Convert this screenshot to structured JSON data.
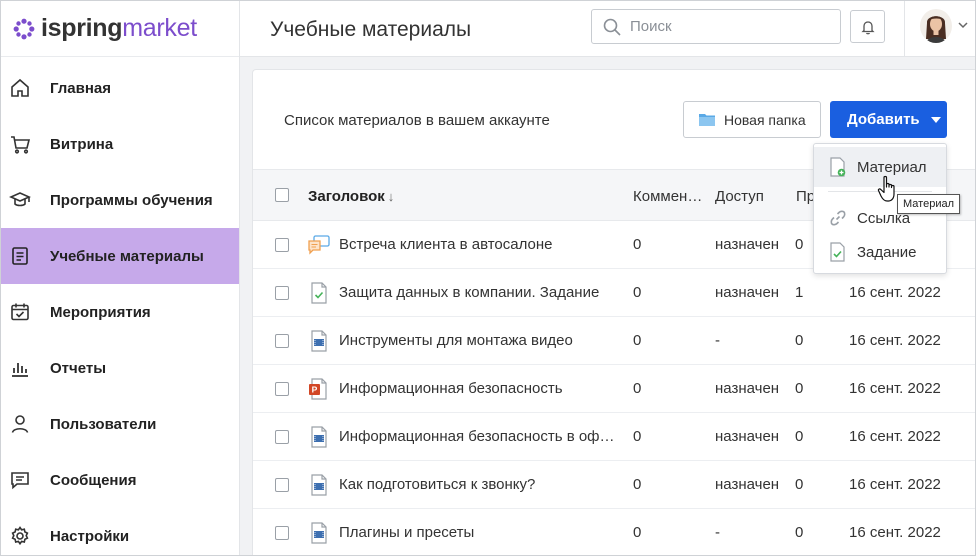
{
  "brand": {
    "part1": "ispring",
    "part2": "market",
    "accent": "#7c4dcc"
  },
  "header": {
    "title": "Учебные материалы",
    "search_placeholder": "Поиск"
  },
  "sidebar": {
    "items": [
      {
        "label": "Главная",
        "icon": "home-icon"
      },
      {
        "label": "Витрина",
        "icon": "cart-icon"
      },
      {
        "label": "Программы обучения",
        "icon": "graduation-cap-icon"
      },
      {
        "label": "Учебные материалы",
        "icon": "document-list-icon",
        "active": true
      },
      {
        "label": "Мероприятия",
        "icon": "calendar-check-icon"
      },
      {
        "label": "Отчеты",
        "icon": "bar-chart-icon"
      },
      {
        "label": "Пользователи",
        "icon": "user-icon"
      },
      {
        "label": "Сообщения",
        "icon": "message-icon"
      },
      {
        "label": "Настройки",
        "icon": "gear-icon"
      }
    ],
    "active_color": "#c6a9ea"
  },
  "content": {
    "caption": "Список материалов в вашем аккаунте",
    "new_folder_label": "Новая папка",
    "add_label": "Добавить",
    "add_color": "#1a5fe0"
  },
  "table": {
    "headers": {
      "title": "Заголовок",
      "sort": "↓",
      "comments": "Коммен…",
      "access": "Доступ",
      "progress": "Пр"
    },
    "rows": [
      {
        "icon": "dialog-sim-icon",
        "title": "Встреча клиента в автосалоне",
        "comments": "0",
        "access": "назначен",
        "progress": "0",
        "date": ""
      },
      {
        "icon": "assignment-icon",
        "title": "Защита данных в компании. Задание",
        "comments": "0",
        "access": "назначен",
        "progress": "1",
        "date": "16 сент. 2022"
      },
      {
        "icon": "video-icon",
        "title": "Инструменты для монтажа видео",
        "comments": "0",
        "access": "-",
        "progress": "0",
        "date": "16 сент. 2022"
      },
      {
        "icon": "powerpoint-icon",
        "title": "Информационная безопасность",
        "comments": "0",
        "access": "назначен",
        "progress": "0",
        "date": "16 сент. 2022"
      },
      {
        "icon": "video-icon",
        "title": "Информационная безопасность в офисе",
        "comments": "0",
        "access": "назначен",
        "progress": "0",
        "date": "16 сент. 2022"
      },
      {
        "icon": "video-icon",
        "title": "Как подготовиться к звонку?",
        "comments": "0",
        "access": "назначен",
        "progress": "0",
        "date": "16 сент. 2022"
      },
      {
        "icon": "video-icon",
        "title": "Плагины и пресеты",
        "comments": "0",
        "access": "-",
        "progress": "0",
        "date": "16 сент. 2022"
      }
    ]
  },
  "dropdown": {
    "items": [
      {
        "label": "Материал",
        "icon": "file-add-icon"
      },
      {
        "label": "Ссылка",
        "icon": "link-icon"
      },
      {
        "label": "Задание",
        "icon": "assignment-icon"
      }
    ],
    "tooltip": "Материал"
  }
}
